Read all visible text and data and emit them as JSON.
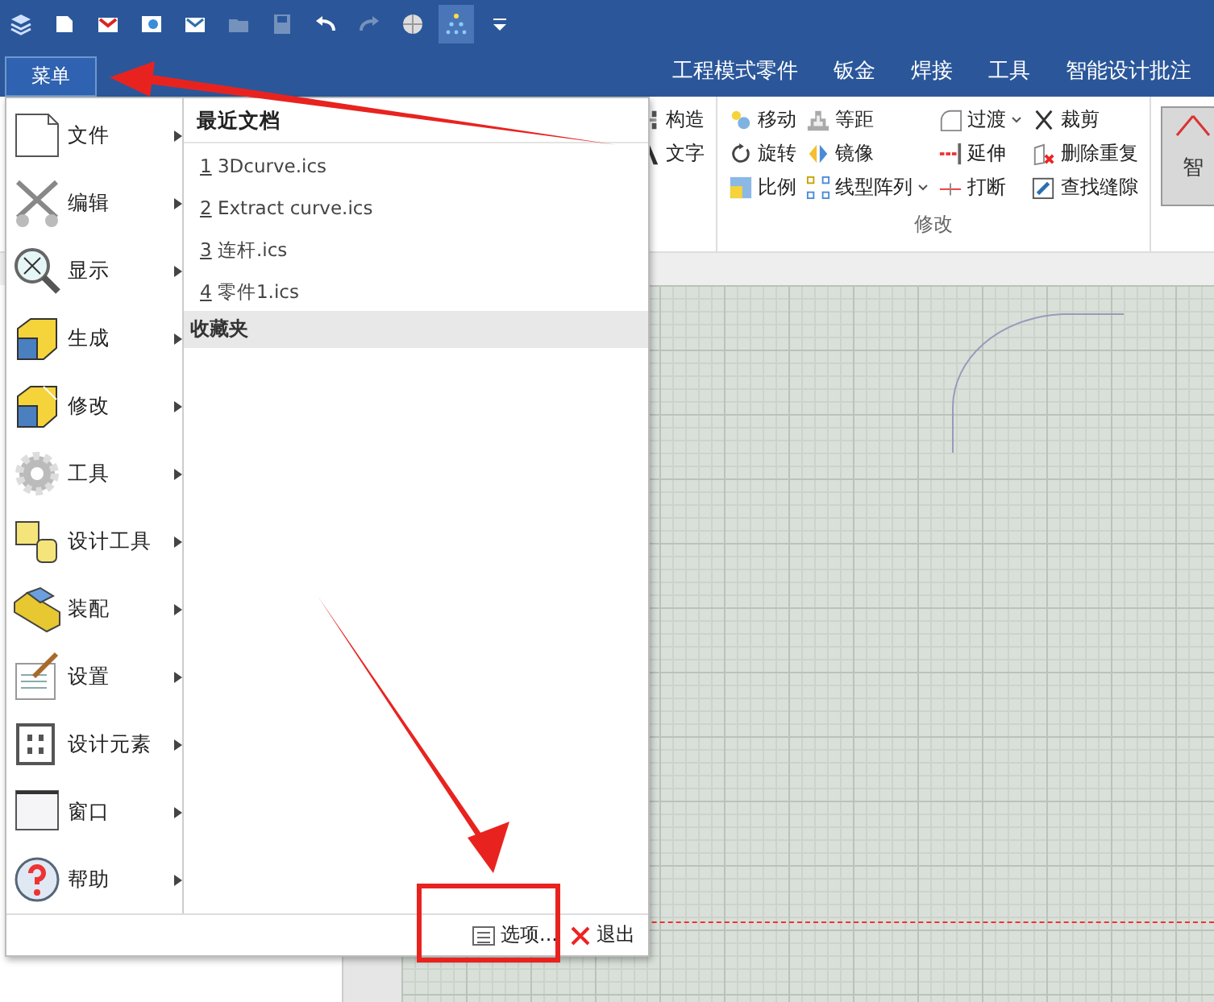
{
  "quick_access": [
    {
      "kind": "logo",
      "disabled": false,
      "highlighted": false
    },
    {
      "kind": "new",
      "disabled": false,
      "highlighted": false
    },
    {
      "kind": "open",
      "disabled": false,
      "highlighted": false
    },
    {
      "kind": "import",
      "disabled": false,
      "highlighted": false
    },
    {
      "kind": "mail",
      "disabled": false,
      "highlighted": false
    },
    {
      "kind": "folder",
      "disabled": true,
      "highlighted": false
    },
    {
      "kind": "save",
      "disabled": true,
      "highlighted": false
    },
    {
      "kind": "undo",
      "disabled": false,
      "highlighted": false
    },
    {
      "kind": "redo",
      "disabled": true,
      "highlighted": false
    },
    {
      "kind": "globe",
      "disabled": false,
      "highlighted": false
    },
    {
      "kind": "tree",
      "disabled": false,
      "highlighted": true
    },
    {
      "kind": "more",
      "disabled": false,
      "highlighted": false
    }
  ],
  "menu_button": {
    "label": "菜单",
    "selected": true
  },
  "ribbon_tabs": [
    {
      "label": "工程模式零件",
      "selected": false
    },
    {
      "label": "钣金",
      "selected": false
    },
    {
      "label": "焊接",
      "selected": false
    },
    {
      "label": "工具",
      "selected": false
    },
    {
      "label": "智能设计批注",
      "selected": false
    }
  ],
  "ribbon_groups": [
    {
      "columns": [
        [
          {
            "label": "构造",
            "kind": "construct",
            "dropdown": false
          },
          {
            "label": "文字",
            "kind": "text",
            "dropdown": false
          }
        ]
      ]
    },
    {
      "label": "修改",
      "columns": [
        [
          {
            "label": "移动",
            "kind": "move",
            "dropdown": false
          },
          {
            "label": "旋转",
            "kind": "rotate",
            "dropdown": false
          },
          {
            "label": "比例",
            "kind": "scale",
            "dropdown": false
          }
        ],
        [
          {
            "label": "等距",
            "kind": "offset",
            "dropdown": false
          },
          {
            "label": "镜像",
            "kind": "mirror",
            "dropdown": false
          },
          {
            "label": "线型阵列",
            "kind": "pattern",
            "dropdown": true
          }
        ],
        [
          {
            "label": "过渡",
            "kind": "fillet",
            "dropdown": true
          },
          {
            "label": "延伸",
            "kind": "extend",
            "dropdown": false
          },
          {
            "label": "打断",
            "kind": "break",
            "dropdown": false
          }
        ],
        [
          {
            "label": "裁剪",
            "kind": "trim",
            "dropdown": false
          },
          {
            "label": "删除重复",
            "kind": "delete",
            "dropdown": false
          },
          {
            "label": "查找缝隙",
            "kind": "gaps",
            "dropdown": false
          }
        ]
      ]
    }
  ],
  "ribbon_big_button": {
    "label": "智"
  },
  "app_menu": {
    "categories": [
      {
        "label": "文件",
        "kind": "file"
      },
      {
        "label": "编辑",
        "kind": "edit"
      },
      {
        "label": "显示",
        "kind": "display"
      },
      {
        "label": "生成",
        "kind": "generate"
      },
      {
        "label": "修改",
        "kind": "modify"
      },
      {
        "label": "工具",
        "kind": "tools"
      },
      {
        "label": "设计工具",
        "kind": "design-tools"
      },
      {
        "label": "装配",
        "kind": "assembly"
      },
      {
        "label": "设置",
        "kind": "settings"
      },
      {
        "label": "设计元素",
        "kind": "elements"
      },
      {
        "label": "窗口",
        "kind": "window"
      },
      {
        "label": "帮助",
        "kind": "help"
      }
    ],
    "recent_title": "最近文档",
    "recent": [
      {
        "index": "1",
        "name": "3Dcurve.ics"
      },
      {
        "index": "2",
        "name": "Extract curve.ics"
      },
      {
        "index": "3",
        "name": "连杆.ics"
      },
      {
        "index": "4",
        "name": "零件1.ics"
      }
    ],
    "favorites_title": "收藏夹",
    "footer": [
      {
        "label": "选项...",
        "kind": "options"
      },
      {
        "label": "退出",
        "kind": "exit"
      }
    ]
  }
}
